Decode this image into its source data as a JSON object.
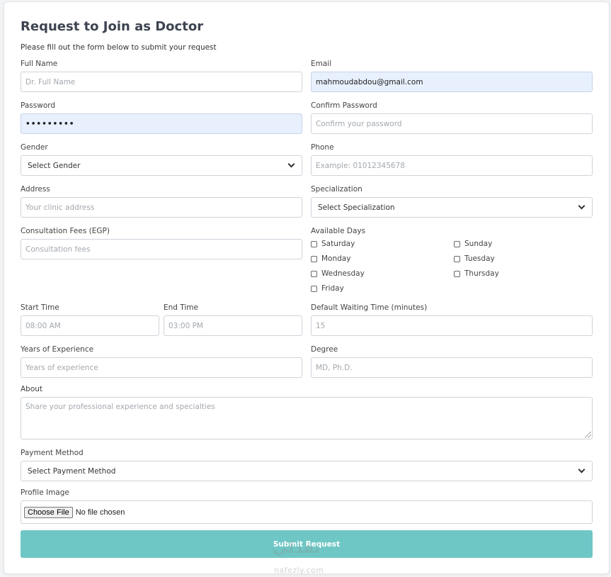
{
  "form": {
    "title": "Request to Join as Doctor",
    "subtitle": "Please fill out the form below to submit your request"
  },
  "fields": {
    "full_name": {
      "label": "Full Name",
      "placeholder": "Dr. Full Name",
      "value": ""
    },
    "email": {
      "label": "Email",
      "value": "mahmoudabdou@gmail.com"
    },
    "password": {
      "label": "Password",
      "value": "•••••••••"
    },
    "confirm_password": {
      "label": "Confirm Password",
      "placeholder": "Confirm your password"
    },
    "gender": {
      "label": "Gender",
      "selected": "Select Gender"
    },
    "phone": {
      "label": "Phone",
      "placeholder": "Example: 01012345678"
    },
    "address": {
      "label": "Address",
      "placeholder": "Your clinic address"
    },
    "specialization": {
      "label": "Specialization",
      "selected": "Select Specialization"
    },
    "consultation_fees": {
      "label": "Consultation Fees (EGP)",
      "placeholder": "Consultation fees"
    },
    "start_time": {
      "label": "Start Time",
      "placeholder": "08:00 AM"
    },
    "end_time": {
      "label": "End Time",
      "placeholder": "03:00 PM"
    },
    "waiting_time": {
      "label": "Default Waiting Time (minutes)",
      "placeholder": "15"
    },
    "experience": {
      "label": "Years of Experience",
      "placeholder": "Years of experience"
    },
    "degree": {
      "label": "Degree",
      "placeholder": "MD, Ph.D."
    },
    "about": {
      "label": "About",
      "placeholder": "Share your professional experience and specialties"
    },
    "payment_method": {
      "label": "Payment Method",
      "selected": "Select Payment Method"
    },
    "profile_image": {
      "label": "Profile Image",
      "button": "Choose File",
      "status": "No file chosen"
    }
  },
  "available_days": {
    "label": "Available Days",
    "days": [
      "Saturday",
      "Sunday",
      "Monday",
      "Tuesday",
      "Wednesday",
      "Thursday",
      "Friday"
    ]
  },
  "submit": {
    "label": "Submit Request"
  },
  "watermark": {
    "arabic": "نفذلي",
    "latin": "nafezly.com"
  },
  "colors": {
    "accent": "#6fc7c5",
    "autofill": "#e8f0fe"
  }
}
